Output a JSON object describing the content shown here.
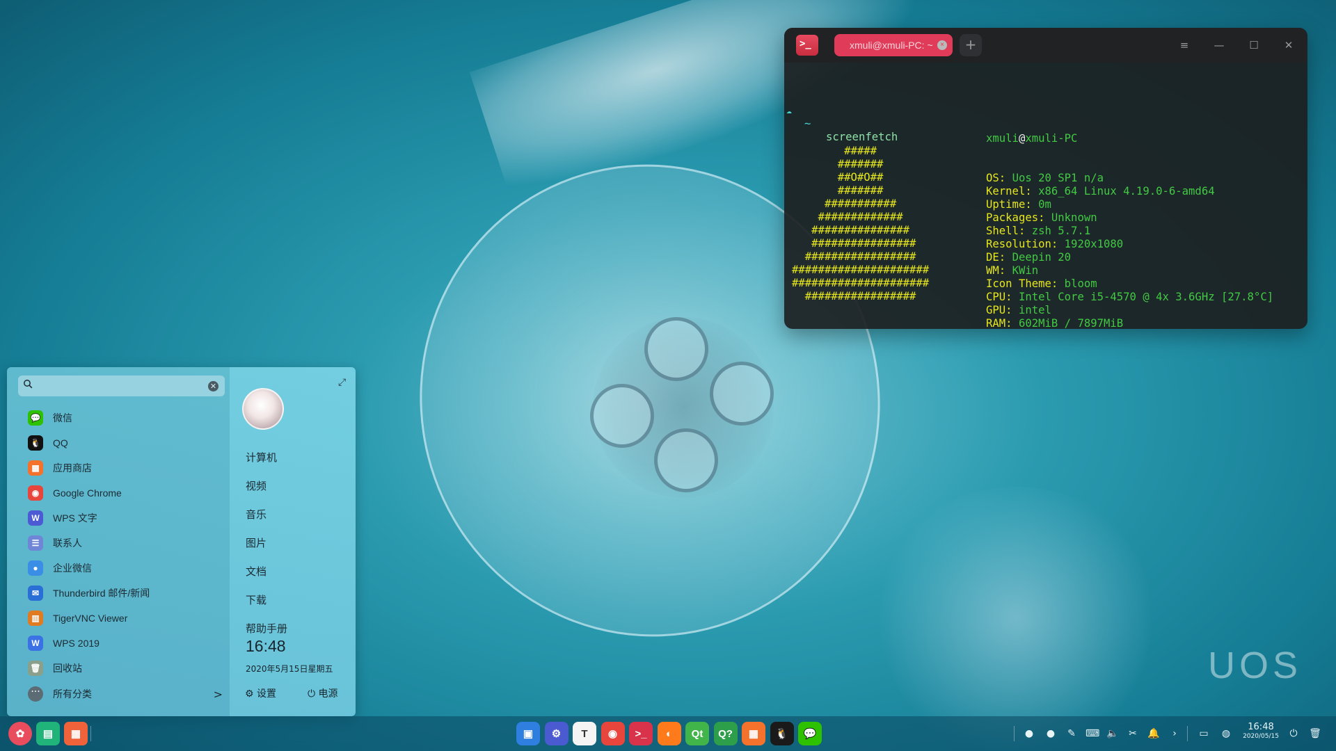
{
  "desktop": {
    "watermark": "UOS"
  },
  "terminal": {
    "tab_title": "xmuli@xmuli-PC: ~",
    "tab_close": "×",
    "new_tab": "+",
    "menu_icon": "≡",
    "minimize_icon": "—",
    "maximize_icon": "☐",
    "close_icon": "✕",
    "prompt_symbol": "~",
    "command": "screenfetch",
    "info": {
      "user": "xmuli",
      "at": "@",
      "host": "xmuli-PC",
      "lines": [
        {
          "key": "OS: ",
          "value": "Uos 20 SP1 n/a"
        },
        {
          "key": "Kernel: ",
          "value": "x86_64 Linux 4.19.0-6-amd64"
        },
        {
          "key": "Uptime: ",
          "value": "0m"
        },
        {
          "key": "Packages: ",
          "value": "Unknown"
        },
        {
          "key": "Shell: ",
          "value": "zsh 5.7.1"
        },
        {
          "key": "Resolution: ",
          "value": "1920x1080"
        },
        {
          "key": "DE: ",
          "value": "Deepin 20"
        },
        {
          "key": "WM: ",
          "value": "KWin"
        },
        {
          "key": "Icon Theme: ",
          "value": "bloom"
        },
        {
          "key": "CPU: ",
          "value": "Intel Core i5-4570 @ 4x 3.6GHz [27.8°C]"
        },
        {
          "key": "GPU: ",
          "value": "intel"
        },
        {
          "key": "RAM: ",
          "value": "602MiB / 7897MiB"
        }
      ]
    },
    "ascii_art": [
      "        #####",
      "       #######",
      "       ##O#O##",
      "       #######",
      "     ###########",
      "    #############",
      "   ###############",
      "   ################",
      "  #################",
      "#####################",
      "#####################",
      "  #################"
    ]
  },
  "launcher": {
    "search_placeholder": "",
    "apps": [
      {
        "label": "微信",
        "icon": "wechat-icon",
        "color": "#2dc100",
        "glyph": "💬"
      },
      {
        "label": "QQ",
        "icon": "qq-icon",
        "color": "#111111",
        "glyph": "🐧"
      },
      {
        "label": "应用商店",
        "icon": "app-store-icon",
        "color": "#f5722d",
        "glyph": "▦"
      },
      {
        "label": "Google Chrome",
        "icon": "chrome-icon",
        "color": "#e8453c",
        "glyph": "◉"
      },
      {
        "label": "WPS 文字",
        "icon": "wps-writer-icon",
        "color": "#4c5bd4",
        "glyph": "W"
      },
      {
        "label": "联系人",
        "icon": "contacts-icon",
        "color": "#6f86d6",
        "glyph": "☰"
      },
      {
        "label": "企业微信",
        "icon": "wecom-icon",
        "color": "#3a8ee6",
        "glyph": "●"
      },
      {
        "label": "Thunderbird 邮件/新闻",
        "icon": "thunderbird-icon",
        "color": "#2a6fd6",
        "glyph": "✉"
      },
      {
        "label": "TigerVNC Viewer",
        "icon": "tigervnc-icon",
        "color": "#e07b22",
        "glyph": "▥"
      },
      {
        "label": "WPS 2019",
        "icon": "wps-2019-icon",
        "color": "#3a72e6",
        "glyph": "W"
      },
      {
        "label": "回收站",
        "icon": "trash-icon",
        "color": "#8aa08a",
        "glyph": "🗑"
      }
    ],
    "all_categories": "所有分类",
    "all_categories_chevron": ">",
    "expand_icon": "⤢",
    "places": [
      "计算机",
      "视频",
      "音乐",
      "图片",
      "文档",
      "下载",
      "帮助手册"
    ],
    "time": "16:48",
    "date": "2020年5月15日星期五",
    "settings_label": "设置",
    "power_label": "电源"
  },
  "taskbar": {
    "time": "16:48",
    "date": "2020/05/15",
    "apps": [
      {
        "name": "launcher",
        "icon": "launcher-icon",
        "color": "#e94c5c",
        "glyph": "✿"
      },
      {
        "name": "multitask-view",
        "icon": "multitask-icon",
        "color": "#20b37a",
        "glyph": "▤"
      },
      {
        "name": "workspace",
        "icon": "workspace-icon",
        "color": "#f0623a",
        "glyph": "▦"
      }
    ],
    "dock": [
      {
        "name": "file-manager",
        "icon": "file-manager-icon",
        "color": "#2f7fe0",
        "glyph": "▣"
      },
      {
        "name": "settings",
        "icon": "settings-icon",
        "color": "#4a5ad0",
        "glyph": "⚙"
      },
      {
        "name": "text-editor",
        "icon": "text-editor-icon",
        "color": "#f4f4f4",
        "glyph": "T"
      },
      {
        "name": "chrome",
        "icon": "chrome-icon",
        "color": "#e8453c",
        "glyph": "◉"
      },
      {
        "name": "terminal",
        "icon": "terminal-icon",
        "color": "#d8334a",
        "glyph": ">_"
      },
      {
        "name": "firefox",
        "icon": "firefox-icon",
        "color": "#ff7a1a",
        "glyph": "◐"
      },
      {
        "name": "qt-creator",
        "icon": "qt-creator-icon",
        "color": "#41b44a",
        "glyph": "Qt"
      },
      {
        "name": "qt-assistant",
        "icon": "qt-assistant-icon",
        "color": "#2d9f4a",
        "glyph": "Q?"
      },
      {
        "name": "app-store",
        "icon": "app-store-icon",
        "color": "#f5722d",
        "glyph": "▦"
      },
      {
        "name": "qq",
        "icon": "qq-icon",
        "color": "#1a1a1a",
        "glyph": "🐧"
      },
      {
        "name": "wechat",
        "icon": "wechat-icon",
        "color": "#2dc100",
        "glyph": "💬"
      }
    ]
  }
}
